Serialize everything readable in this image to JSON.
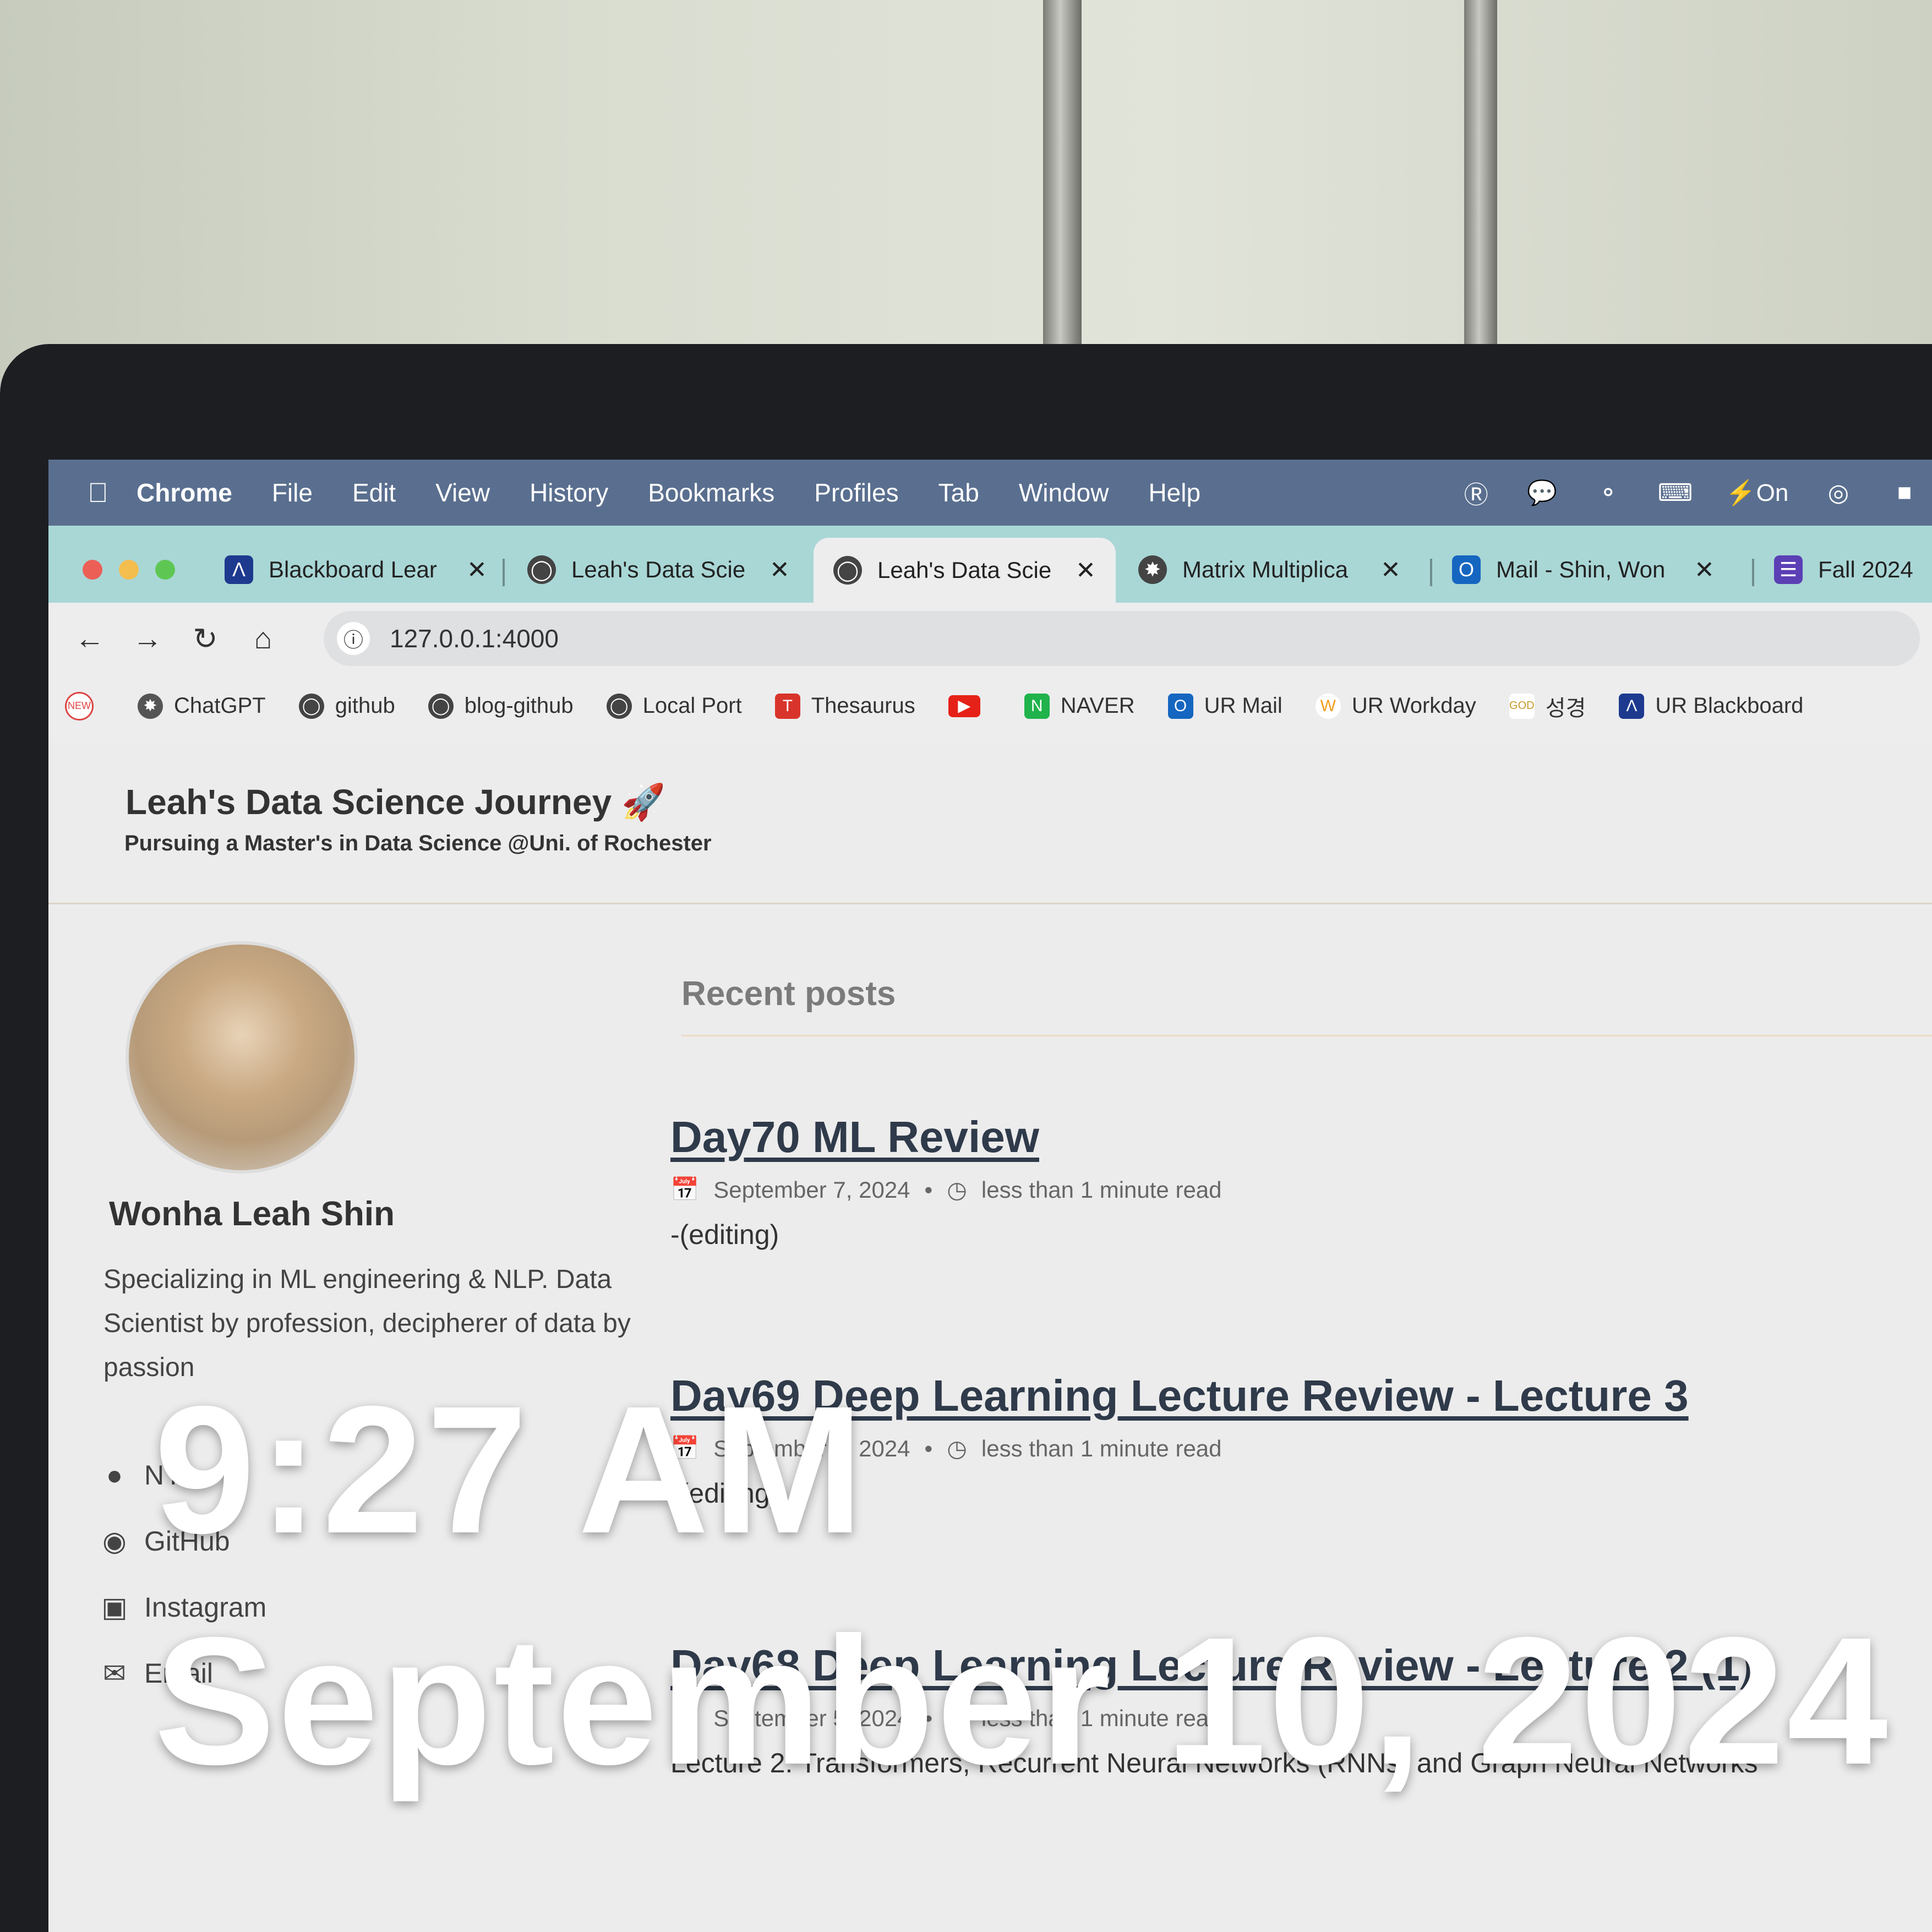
{
  "menubar": {
    "apple_icon": "apple-icon",
    "items": [
      "Chrome",
      "File",
      "Edit",
      "View",
      "History",
      "Bookmarks",
      "Profiles",
      "Tab",
      "Window",
      "Help"
    ],
    "status_on_label": "On"
  },
  "tabs": [
    {
      "label": "Blackboard Lear",
      "color": "#1d3a8f"
    },
    {
      "label": "Leah's Data Scie",
      "color": "#444444"
    },
    {
      "label": "Leah's Data Scie",
      "color": "#444444"
    },
    {
      "label": "Matrix Multiplica",
      "color": "#444444"
    },
    {
      "label": "Mail - Shin, Won",
      "color": "#1566c0"
    },
    {
      "label": "Fall 2024",
      "color": "#5b3fb5"
    }
  ],
  "active_tab_index": 2,
  "address": {
    "url": "127.0.0.1:4000"
  },
  "bookmarks": [
    {
      "label": "ChatGPT"
    },
    {
      "label": "github"
    },
    {
      "label": "blog-github"
    },
    {
      "label": "Local Port"
    },
    {
      "label": "Thesaurus"
    },
    {
      "label": ""
    },
    {
      "label": "NAVER"
    },
    {
      "label": "UR Mail"
    },
    {
      "label": "UR Workday"
    },
    {
      "label": "성경"
    },
    {
      "label": "UR Blackboard"
    }
  ],
  "site": {
    "title": "Leah's Data Science Journey 🚀",
    "subtitle": "Pursuing a Master's in Data Science @Uni. of Rochester"
  },
  "author": {
    "name": "Wonha Leah Shin",
    "bio": "Specializing in ML engineering & NLP. Data Scientist by profession, decipherer of data by passion",
    "links": [
      "NY",
      "GitHub",
      "Instagram",
      "Email"
    ]
  },
  "recent_heading": "Recent posts",
  "posts": [
    {
      "title": "Day70 ML Review",
      "date": "September 7, 2024",
      "read": "less than 1 minute read",
      "excerpt": "-(editing)"
    },
    {
      "title": "Day69 Deep Learning Lecture Review - Lecture 3",
      "date": "September 6, 2024",
      "read": "less than 1 minute read",
      "excerpt": "-(editing)"
    },
    {
      "title": "Day68 Deep Learning Lecture Review - Lecture 2 (1)",
      "date": "September 5, 2024",
      "read": "less than 1 minute read",
      "excerpt": "Lecture 2: Transformers, Recurrent Neural Networks (RNNs) and Graph Neural Networks"
    }
  ],
  "overlay": {
    "time": "9:27 AM",
    "date": "September 10, 2024"
  }
}
